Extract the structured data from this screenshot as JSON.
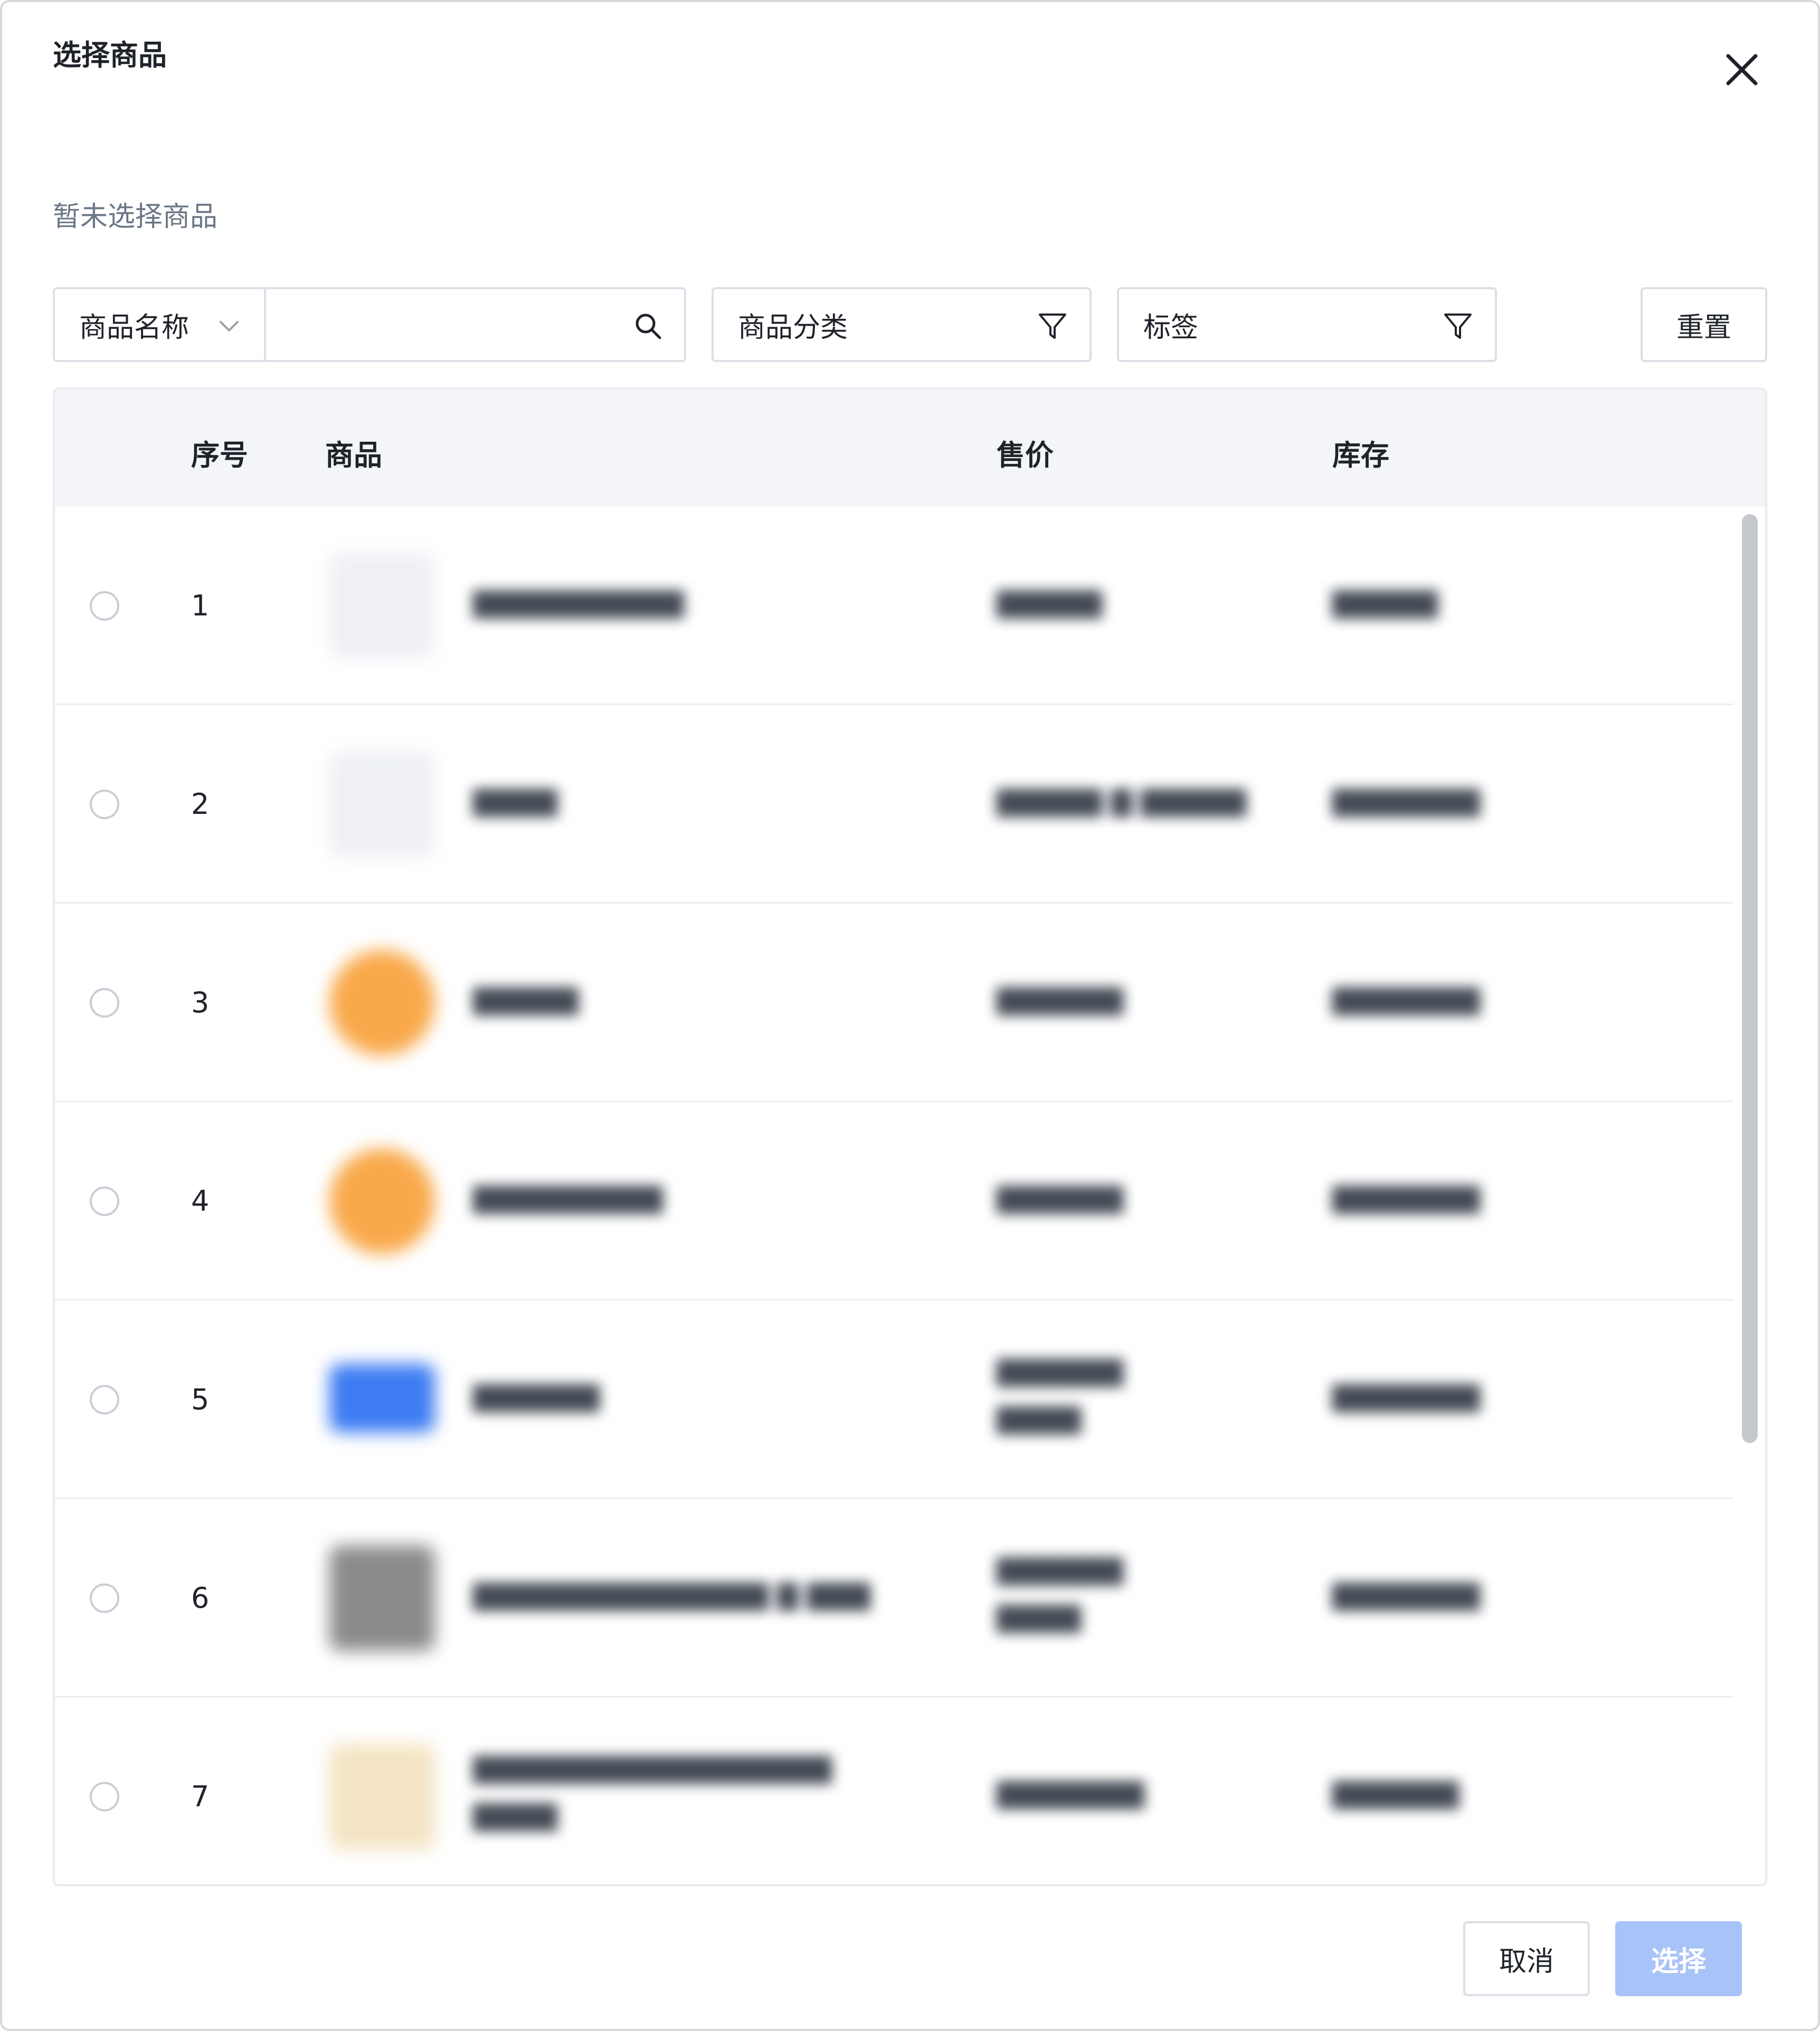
{
  "dialog": {
    "title": "选择商品",
    "selected_hint": "暂未选择商品"
  },
  "filters": {
    "field_select_value": "商品名称",
    "search_value": "",
    "category_label": "商品分类",
    "tag_label": "标签",
    "reset_label": "重置"
  },
  "table": {
    "columns": [
      "序号",
      "商品",
      "售价",
      "库存"
    ],
    "rows": [
      {
        "index": "1",
        "thumb_color": "#f1f3f6"
      },
      {
        "index": "2",
        "thumb_color": "#f1f3f6"
      },
      {
        "index": "3",
        "thumb_color": "#f9a94b"
      },
      {
        "index": "4",
        "thumb_color": "#f9a94b"
      },
      {
        "index": "5",
        "thumb_color": "#3d7cf2"
      },
      {
        "index": "6",
        "thumb_color": "#8b8b8b"
      },
      {
        "index": "7",
        "thumb_color": "#f4e4c4"
      }
    ]
  },
  "footer": {
    "cancel_label": "取消",
    "select_label": "选择"
  },
  "colors": {
    "primary_disabled": "#a8c3f7",
    "header_bg": "#f3f5f9",
    "border": "#dcdfe6"
  },
  "icons": {
    "close": "close-icon",
    "chevron": "chevron-down-icon",
    "search": "search-icon",
    "filter": "filter-icon"
  }
}
